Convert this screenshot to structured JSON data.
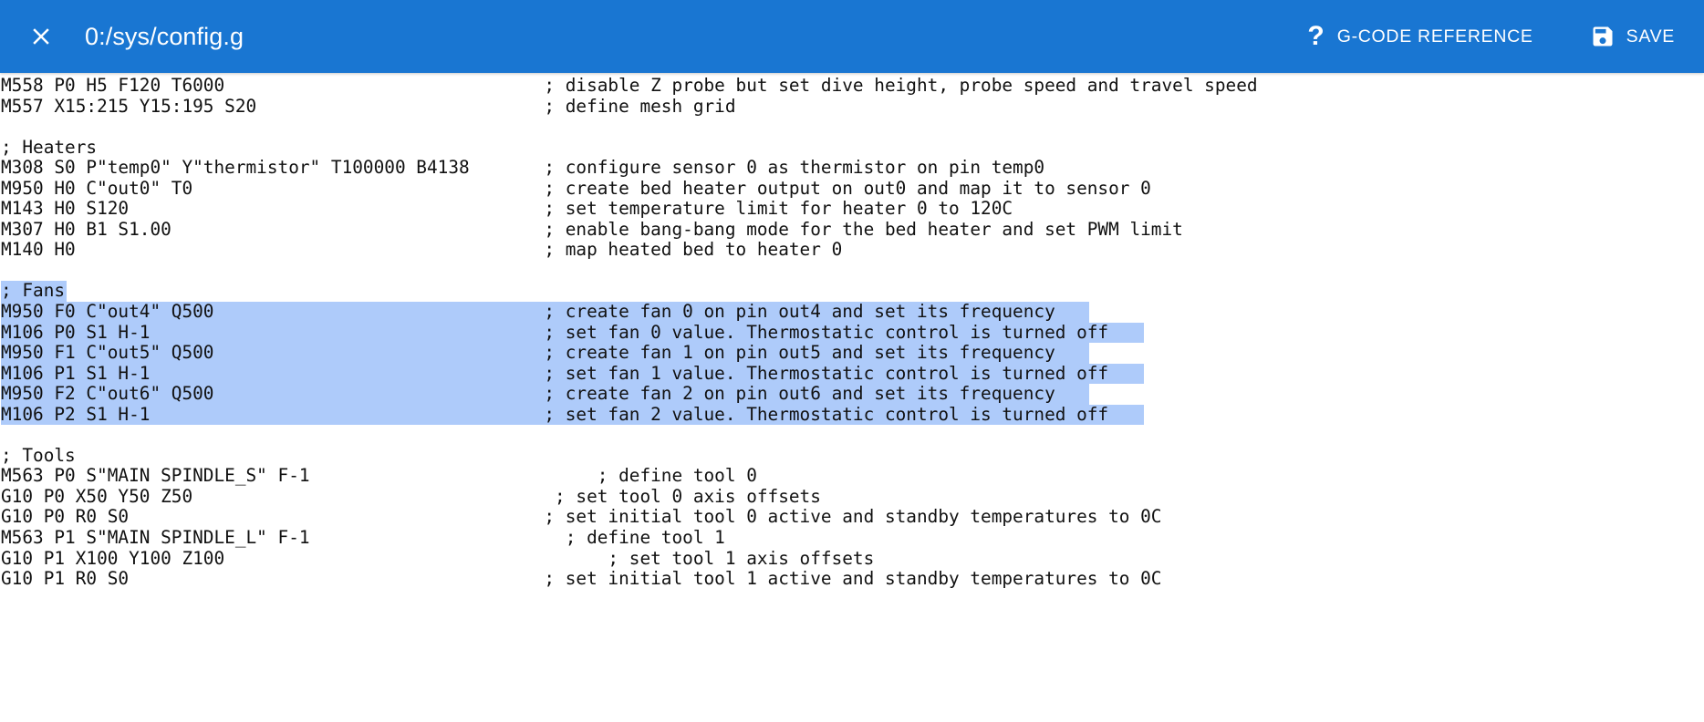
{
  "header": {
    "close_icon": "close-icon",
    "title": "0:/sys/config.g",
    "gcode_reference": {
      "icon": "help-question-icon",
      "icon_glyph": "?",
      "label": "G-CODE REFERENCE"
    },
    "save": {
      "icon": "floppy-disk-save-icon",
      "label": "SAVE"
    },
    "background_color": "#1976D2",
    "text_color": "#FFFFFF"
  },
  "editor": {
    "background_color": "#FFFFFF",
    "text_color": "#111111",
    "selection_color": "#AECBFA",
    "comment_column_char": 51,
    "lines": [
      {
        "code": "M558 P0 H5 F120 T6000",
        "comment": "; disable Z probe but set dive height, probe speed and travel speed",
        "comment_col": 51,
        "selected": "none"
      },
      {
        "code": "M557 X15:215 Y15:195 S20",
        "comment": "; define mesh grid",
        "comment_col": 51,
        "selected": "none"
      },
      {
        "code": "",
        "comment": "",
        "comment_col": 51,
        "selected": "none"
      },
      {
        "code": "; Heaters",
        "comment": "",
        "comment_col": 51,
        "selected": "none"
      },
      {
        "code": "M308 S0 P\"temp0\" Y\"thermistor\" T100000 B4138",
        "comment": "; configure sensor 0 as thermistor on pin temp0",
        "comment_col": 51,
        "selected": "none"
      },
      {
        "code": "M950 H0 C\"out0\" T0",
        "comment": "; create bed heater output on out0 and map it to sensor 0",
        "comment_col": 51,
        "selected": "none"
      },
      {
        "code": "M143 H0 S120",
        "comment": "; set temperature limit for heater 0 to 120C",
        "comment_col": 51,
        "selected": "none"
      },
      {
        "code": "M307 H0 B1 S1.00",
        "comment": "; enable bang-bang mode for the bed heater and set PWM limit",
        "comment_col": 51,
        "selected": "none"
      },
      {
        "code": "M140 H0",
        "comment": "; map heated bed to heater 0",
        "comment_col": 51,
        "selected": "none"
      },
      {
        "code": "",
        "comment": "",
        "comment_col": 51,
        "selected": "none"
      },
      {
        "code": "; Fans",
        "comment": "",
        "comment_col": 51,
        "selected": "text"
      },
      {
        "code": "M950 F0 C\"out4\" Q500",
        "comment": "; create fan 0 on pin out4 and set its frequency",
        "comment_col": 51,
        "selected": "full"
      },
      {
        "code": "M106 P0 S1 H-1",
        "comment": "; set fan 0 value. Thermostatic control is turned off",
        "comment_col": 51,
        "selected": "full"
      },
      {
        "code": "M950 F1 C\"out5\" Q500",
        "comment": "; create fan 1 on pin out5 and set its frequency",
        "comment_col": 51,
        "selected": "full"
      },
      {
        "code": "M106 P1 S1 H-1",
        "comment": "; set fan 1 value. Thermostatic control is turned off",
        "comment_col": 51,
        "selected": "full"
      },
      {
        "code": "M950 F2 C\"out6\" Q500",
        "comment": "; create fan 2 on pin out6 and set its frequency",
        "comment_col": 51,
        "selected": "full"
      },
      {
        "code": "M106 P2 S1 H-1",
        "comment": "; set fan 2 value. Thermostatic control is turned off",
        "comment_col": 51,
        "selected": "full"
      },
      {
        "code": "",
        "comment": "",
        "comment_col": 51,
        "selected": "none"
      },
      {
        "code": "; Tools",
        "comment": "",
        "comment_col": 51,
        "selected": "none"
      },
      {
        "code": "M563 P0 S\"MAIN SPINDLE_S\" F-1",
        "comment": "; define tool 0",
        "comment_col": 56,
        "selected": "none"
      },
      {
        "code": "G10 P0 X50 Y50 Z50",
        "comment": "; set tool 0 axis offsets",
        "comment_col": 52,
        "selected": "none"
      },
      {
        "code": "G10 P0 R0 S0",
        "comment": "; set initial tool 0 active and standby temperatures to 0C",
        "comment_col": 51,
        "selected": "none"
      },
      {
        "code": "M563 P1 S\"MAIN SPINDLE_L\" F-1",
        "comment": "; define tool 1",
        "comment_col": 53,
        "selected": "none"
      },
      {
        "code": "G10 P1 X100 Y100 Z100",
        "comment": "; set tool 1 axis offsets",
        "comment_col": 57,
        "selected": "none"
      },
      {
        "code": "G10 P1 R0 S0",
        "comment": "; set initial tool 1 active and standby temperatures to 0C",
        "comment_col": 51,
        "selected": "none"
      }
    ]
  }
}
